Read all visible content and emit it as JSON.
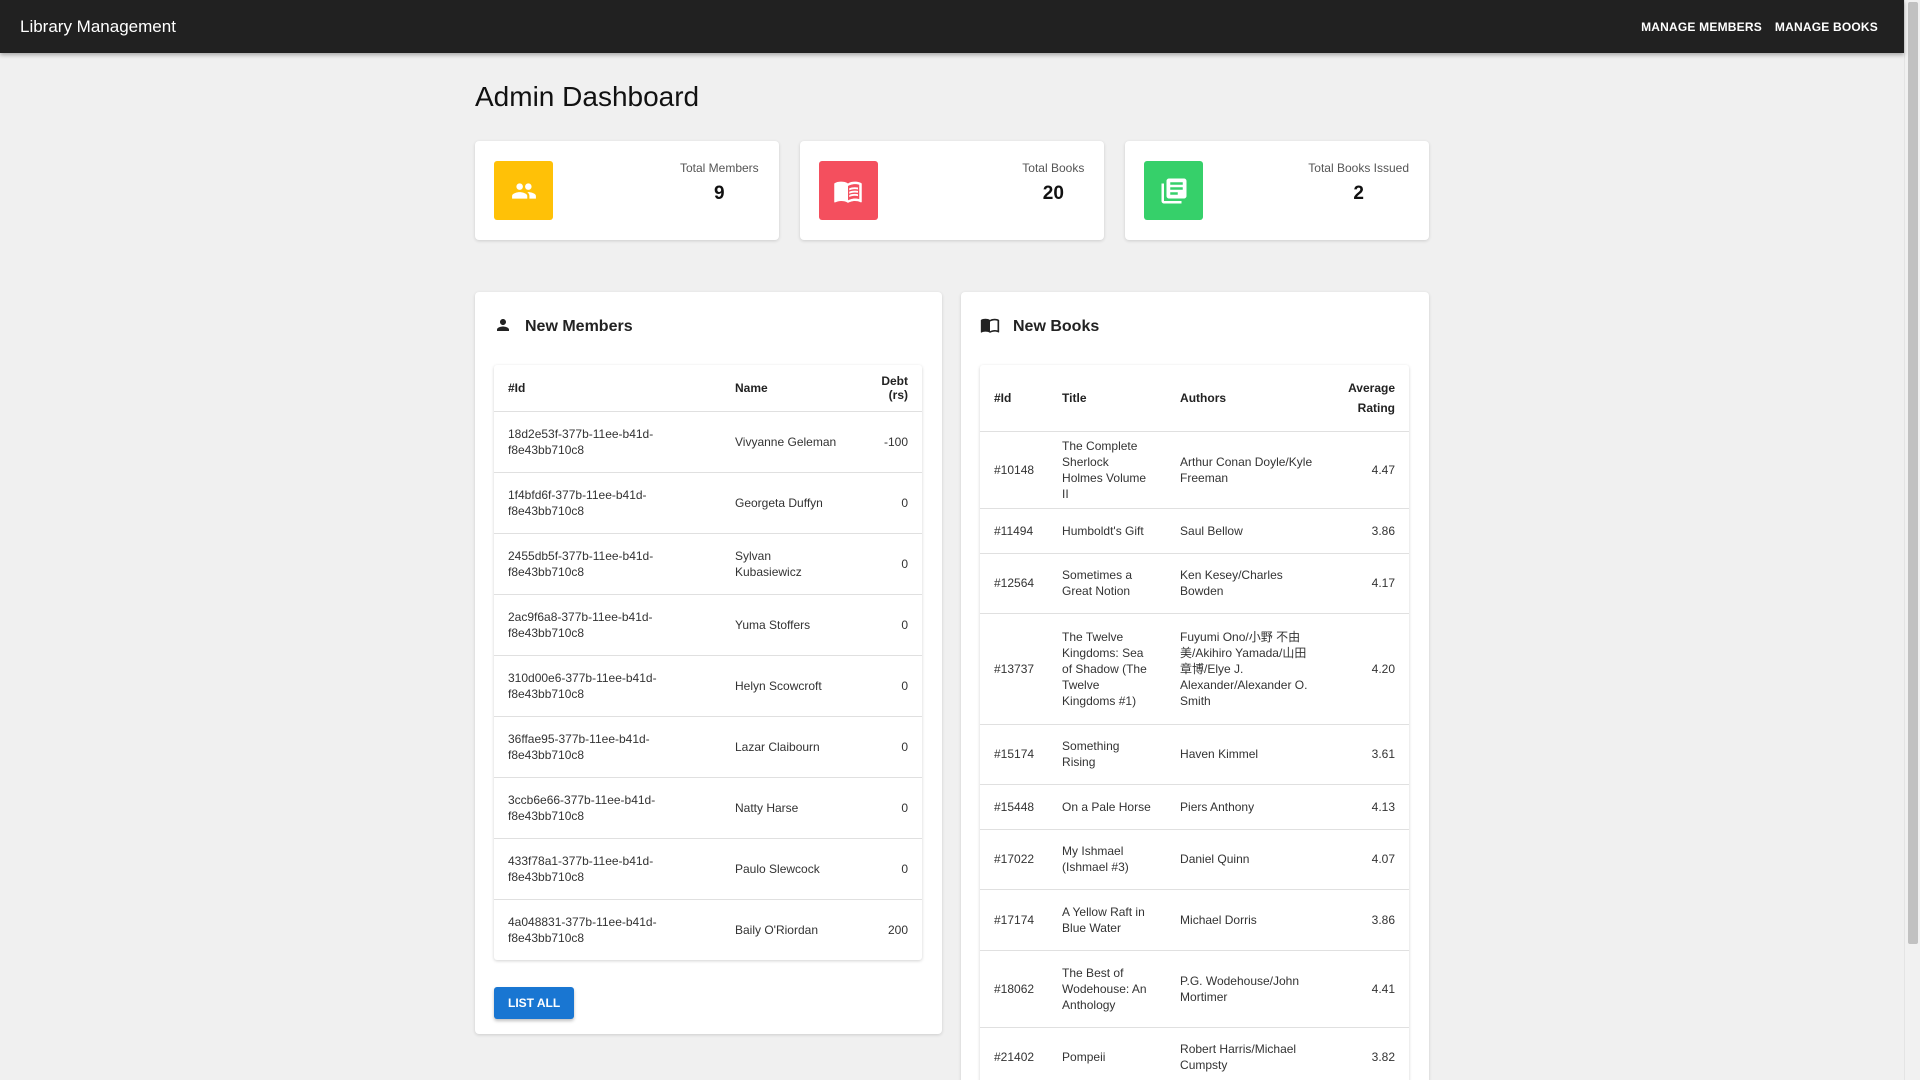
{
  "app": {
    "title": "Library Management"
  },
  "nav": [
    {
      "label": "MANAGE MEMBERS"
    },
    {
      "label": "MANAGE BOOKS"
    }
  ],
  "page": {
    "title": "Admin Dashboard"
  },
  "stats": [
    {
      "label": "Total Members",
      "value": "9",
      "icon": "people-icon",
      "color": "#ffc107"
    },
    {
      "label": "Total Books",
      "value": "20",
      "icon": "book-icon",
      "color": "#f44f5e"
    },
    {
      "label": "Total Books Issued",
      "value": "2",
      "icon": "list-icon",
      "color": "#36d06a"
    }
  ],
  "members": {
    "title": "New Members",
    "icon": "person-icon",
    "columns": [
      "#Id",
      "Name",
      "Debt (rs)"
    ],
    "rows": [
      {
        "id": "18d2e53f-377b-11ee-b41d-f8e43bb710c8",
        "name": "Vivyanne Geleman",
        "debt": "-100"
      },
      {
        "id": "1f4bfd6f-377b-11ee-b41d-f8e43bb710c8",
        "name": "Georgeta Duffyn",
        "debt": "0"
      },
      {
        "id": "2455db5f-377b-11ee-b41d-f8e43bb710c8",
        "name": "Sylvan Kubasiewicz",
        "debt": "0"
      },
      {
        "id": "2ac9f6a8-377b-11ee-b41d-f8e43bb710c8",
        "name": "Yuma Stoffers",
        "debt": "0"
      },
      {
        "id": "310d00e6-377b-11ee-b41d-f8e43bb710c8",
        "name": "Helyn Scowcroft",
        "debt": "0"
      },
      {
        "id": "36ffae95-377b-11ee-b41d-f8e43bb710c8",
        "name": "Lazar Claibourn",
        "debt": "0"
      },
      {
        "id": "3ccb6e66-377b-11ee-b41d-f8e43bb710c8",
        "name": "Natty Harse",
        "debt": "0"
      },
      {
        "id": "433f78a1-377b-11ee-b41d-f8e43bb710c8",
        "name": "Paulo Slewcock",
        "debt": "0"
      },
      {
        "id": "4a048831-377b-11ee-b41d-f8e43bb710c8",
        "name": "Baily O'Riordan",
        "debt": "200"
      }
    ],
    "list_all_label": "LIST ALL"
  },
  "books": {
    "title": "New Books",
    "icon": "open-book-icon",
    "columns": [
      "#Id",
      "Title",
      "Authors",
      "Average Rating"
    ],
    "rows": [
      {
        "id": "#10148",
        "title": "The Complete Sherlock Holmes Volume II",
        "authors": "Arthur Conan Doyle/Kyle Freeman",
        "rating": "4.47"
      },
      {
        "id": "#11494",
        "title": "Humboldt's Gift",
        "authors": "Saul Bellow",
        "rating": "3.86"
      },
      {
        "id": "#12564",
        "title": "Sometimes a Great Notion",
        "authors": "Ken Kesey/Charles Bowden",
        "rating": "4.17"
      },
      {
        "id": "#13737",
        "title": "The Twelve Kingdoms: Sea of Shadow (The Twelve Kingdoms #1)",
        "authors": "Fuyumi Ono/小野 不由美/Akihiro Yamada/山田 章博/Elye J. Alexander/Alexander O. Smith",
        "rating": "4.20"
      },
      {
        "id": "#15174",
        "title": "Something Rising",
        "authors": "Haven Kimmel",
        "rating": "3.61"
      },
      {
        "id": "#15448",
        "title": "On a Pale Horse",
        "authors": "Piers Anthony",
        "rating": "4.13"
      },
      {
        "id": "#17022",
        "title": "My Ishmael (Ishmael #3)",
        "authors": "Daniel Quinn",
        "rating": "4.07"
      },
      {
        "id": "#17174",
        "title": "A Yellow Raft in Blue Water",
        "authors": "Michael Dorris",
        "rating": "3.86"
      },
      {
        "id": "#18062",
        "title": "The Best of Wodehouse: An Anthology",
        "authors": "P.G. Wodehouse/John Mortimer",
        "rating": "4.41"
      },
      {
        "id": "#21402",
        "title": "Pompeii",
        "authors": "Robert Harris/Michael Cumpsty",
        "rating": "3.82"
      }
    ]
  }
}
